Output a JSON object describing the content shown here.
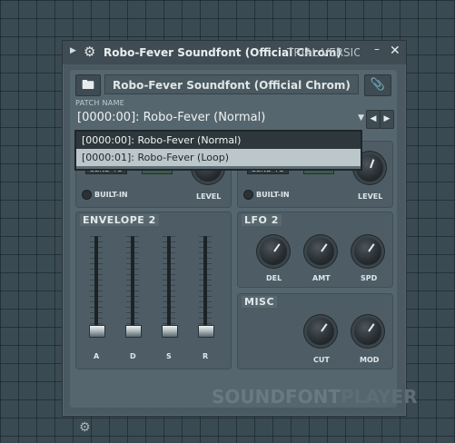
{
  "window": {
    "title": "Robo-Fever Soundfont (Official Chrom)",
    "trial": "TRIAL VERSIO...",
    "minimize": "–",
    "close": "✕"
  },
  "header": {
    "name_field": "Robo-Fever Soundfont (Official Chrom)",
    "patch_label": "PATCH NAME",
    "patch_value": "[0000:00]: Robo-Fever (Normal)"
  },
  "dropdown": {
    "options": [
      "[0000:00]: Robo-Fever (Normal)",
      "[0000:01]: Robo-Fever (Loop)"
    ],
    "selected_index": 0
  },
  "reverb": {
    "send_to": "SEND TO",
    "builtin": "BUILT-IN",
    "level": "LEVEL"
  },
  "chorus": {
    "send_to": "SEND TO",
    "builtin": "BUILT-IN",
    "level": "LEVEL"
  },
  "envelope2": {
    "label": "ENVELOPE 2",
    "sliders": [
      {
        "name": "A",
        "level": 0.0
      },
      {
        "name": "D",
        "level": 0.0
      },
      {
        "name": "S",
        "level": 0.0
      },
      {
        "name": "R",
        "level": 0.0
      }
    ]
  },
  "lfo2": {
    "label": "LFO 2",
    "knobs": [
      "DEL",
      "AMT",
      "SPD"
    ]
  },
  "misc": {
    "label": "MISC",
    "knobs": [
      "CUT",
      "MOD"
    ]
  },
  "brand": {
    "part1": "SOUNDFONT",
    "part2": "PLAYER"
  },
  "icons": [
    "folder-icon",
    "gear-icon",
    "paperclip-icon",
    "chevron-left-icon",
    "chevron-right-icon",
    "close-icon",
    "minimize-icon",
    "caret-down-icon"
  ],
  "colors": {
    "background": "#3a4a52",
    "panel": "#56666e",
    "selected_row": "#2d373c",
    "unselected_row": "#bcc7cb"
  }
}
